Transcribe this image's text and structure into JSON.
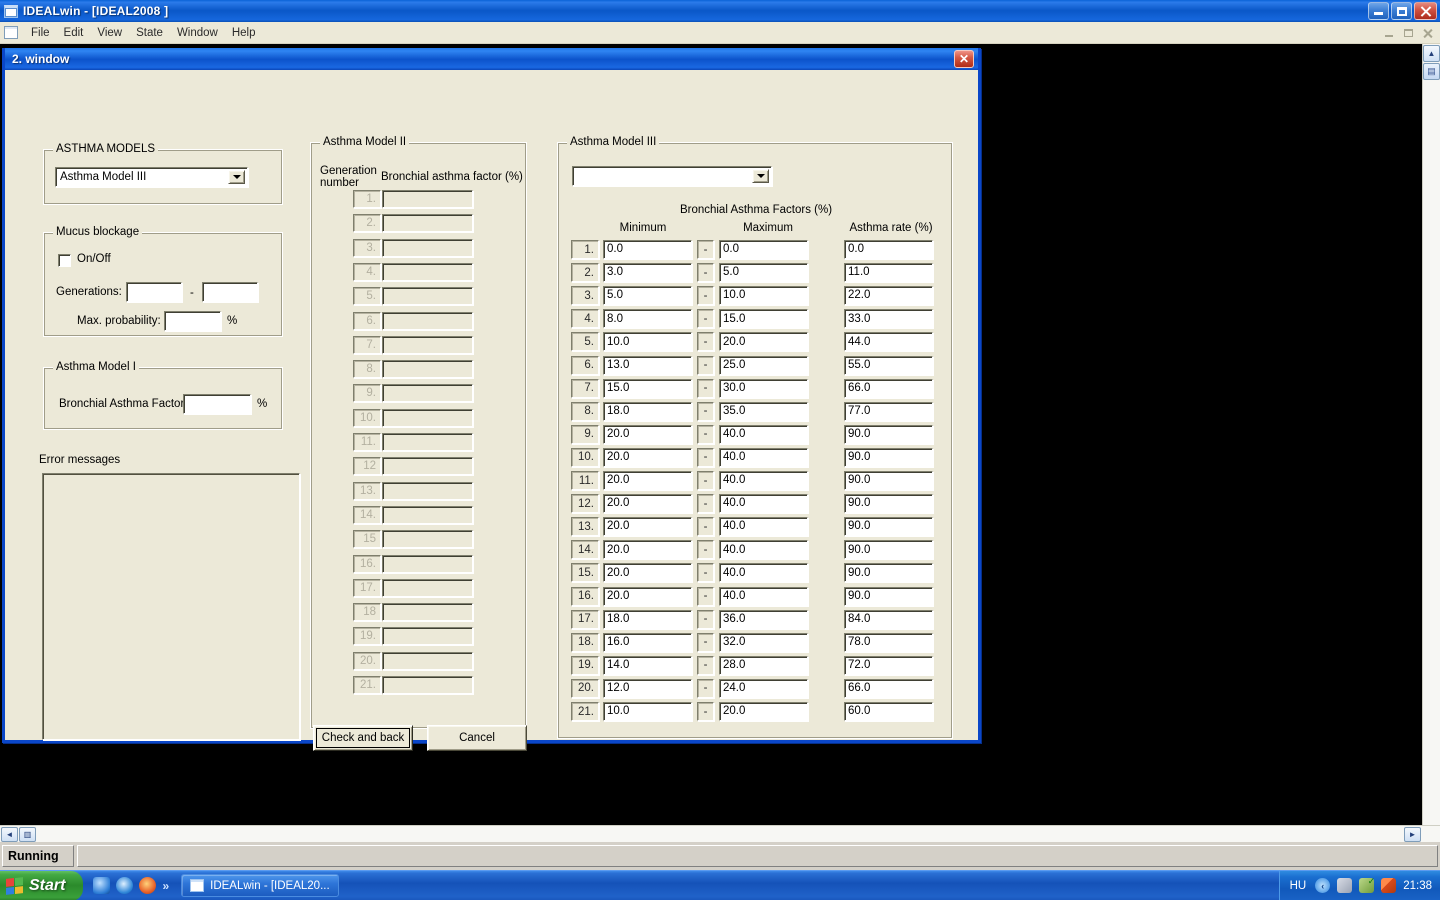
{
  "app": {
    "title": "IDEALwin - [IDEAL2008  ]",
    "window_buttons": {
      "minimize": "_",
      "maximize": "□",
      "close": "✕"
    },
    "menu": [
      "File",
      "Edit",
      "View",
      "State",
      "Window",
      "Help"
    ]
  },
  "dialog": {
    "title": "2. window",
    "close_label": "✕"
  },
  "asthma_models": {
    "group_label": "ASTHMA MODELS",
    "selected": "Asthma Model III"
  },
  "mucus": {
    "group_label": "Mucus blockage",
    "onoff_label": "On/Off",
    "onoff_checked": false,
    "generations_label": "Generations:",
    "generations_from": "",
    "generations_to": "",
    "separator": "-",
    "max_probability_label": "Max. probability:",
    "max_probability_value": "",
    "percent": "%"
  },
  "model1": {
    "group_label": "Asthma Model I",
    "factor_label": "Bronchial Asthma Factor:",
    "factor_value": "",
    "percent": "%"
  },
  "errors": {
    "label": "Error messages",
    "text": ""
  },
  "model2": {
    "group_label": "Asthma Model II",
    "col_generation_line1": "Generation",
    "col_generation_line2": "number",
    "col_factor": "Bronchial asthma factor (%)",
    "rows": [
      {
        "n": "1.",
        "value": ""
      },
      {
        "n": "2.",
        "value": ""
      },
      {
        "n": "3.",
        "value": ""
      },
      {
        "n": "4.",
        "value": ""
      },
      {
        "n": "5.",
        "value": ""
      },
      {
        "n": "6.",
        "value": ""
      },
      {
        "n": "7.",
        "value": ""
      },
      {
        "n": "8.",
        "value": ""
      },
      {
        "n": "9.",
        "value": ""
      },
      {
        "n": "10.",
        "value": ""
      },
      {
        "n": "11.",
        "value": ""
      },
      {
        "n": "12",
        "value": ""
      },
      {
        "n": "13.",
        "value": ""
      },
      {
        "n": "14.",
        "value": ""
      },
      {
        "n": "15",
        "value": ""
      },
      {
        "n": "16.",
        "value": ""
      },
      {
        "n": "17.",
        "value": ""
      },
      {
        "n": "18",
        "value": ""
      },
      {
        "n": "19.",
        "value": ""
      },
      {
        "n": "20.",
        "value": ""
      },
      {
        "n": "21.",
        "value": ""
      }
    ]
  },
  "model3": {
    "group_label": "Asthma Model III",
    "combo_value": "",
    "factors_title": "Bronchial Asthma Factors (%)",
    "col_min": "Minimum",
    "col_max": "Maximum",
    "col_rate": "Asthma rate (%)",
    "separator": "-",
    "rows": [
      {
        "n": "1.",
        "min": "0.0",
        "max": "0.0",
        "rate": "0.0"
      },
      {
        "n": "2.",
        "min": "3.0",
        "max": "5.0",
        "rate": "11.0"
      },
      {
        "n": "3.",
        "min": "5.0",
        "max": "10.0",
        "rate": "22.0"
      },
      {
        "n": "4.",
        "min": "8.0",
        "max": "15.0",
        "rate": "33.0"
      },
      {
        "n": "5.",
        "min": "10.0",
        "max": "20.0",
        "rate": "44.0"
      },
      {
        "n": "6.",
        "min": "13.0",
        "max": "25.0",
        "rate": "55.0"
      },
      {
        "n": "7.",
        "min": "15.0",
        "max": "30.0",
        "rate": "66.0"
      },
      {
        "n": "8.",
        "min": "18.0",
        "max": "35.0",
        "rate": "77.0"
      },
      {
        "n": "9.",
        "min": "20.0",
        "max": "40.0",
        "rate": "90.0"
      },
      {
        "n": "10.",
        "min": "20.0",
        "max": "40.0",
        "rate": "90.0"
      },
      {
        "n": "11.",
        "min": "20.0",
        "max": "40.0",
        "rate": "90.0"
      },
      {
        "n": "12.",
        "min": "20.0",
        "max": "40.0",
        "rate": "90.0"
      },
      {
        "n": "13.",
        "min": "20.0",
        "max": "40.0",
        "rate": "90.0"
      },
      {
        "n": "14.",
        "min": "20.0",
        "max": "40.0",
        "rate": "90.0"
      },
      {
        "n": "15.",
        "min": "20.0",
        "max": "40.0",
        "rate": "90.0"
      },
      {
        "n": "16.",
        "min": "20.0",
        "max": "40.0",
        "rate": "90.0"
      },
      {
        "n": "17.",
        "min": "18.0",
        "max": "36.0",
        "rate": "84.0"
      },
      {
        "n": "18.",
        "min": "16.0",
        "max": "32.0",
        "rate": "78.0"
      },
      {
        "n": "19.",
        "min": "14.0",
        "max": "28.0",
        "rate": "72.0"
      },
      {
        "n": "20.",
        "min": "12.0",
        "max": "24.0",
        "rate": "66.0"
      },
      {
        "n": "21.",
        "min": "10.0",
        "max": "20.0",
        "rate": "60.0"
      }
    ]
  },
  "buttons": {
    "check_and_back": "Check and back",
    "cancel": "Cancel"
  },
  "statusbar": {
    "running": "Running",
    "secondary": ""
  },
  "taskbar": {
    "start": "Start",
    "quick_launch_chevron": "»",
    "tasks": [
      {
        "label": "IDEALwin - [IDEAL20..."
      }
    ],
    "tray_language": "HU",
    "clock": "21:38"
  },
  "colors": {
    "face": "#ece9d8",
    "titlebar_blue": "#0a53c8",
    "dialog_border": "#0a46c8",
    "mdi_background": "#000000",
    "taskbar_blue": "#1552b8",
    "start_green": "#2b8a2b"
  }
}
